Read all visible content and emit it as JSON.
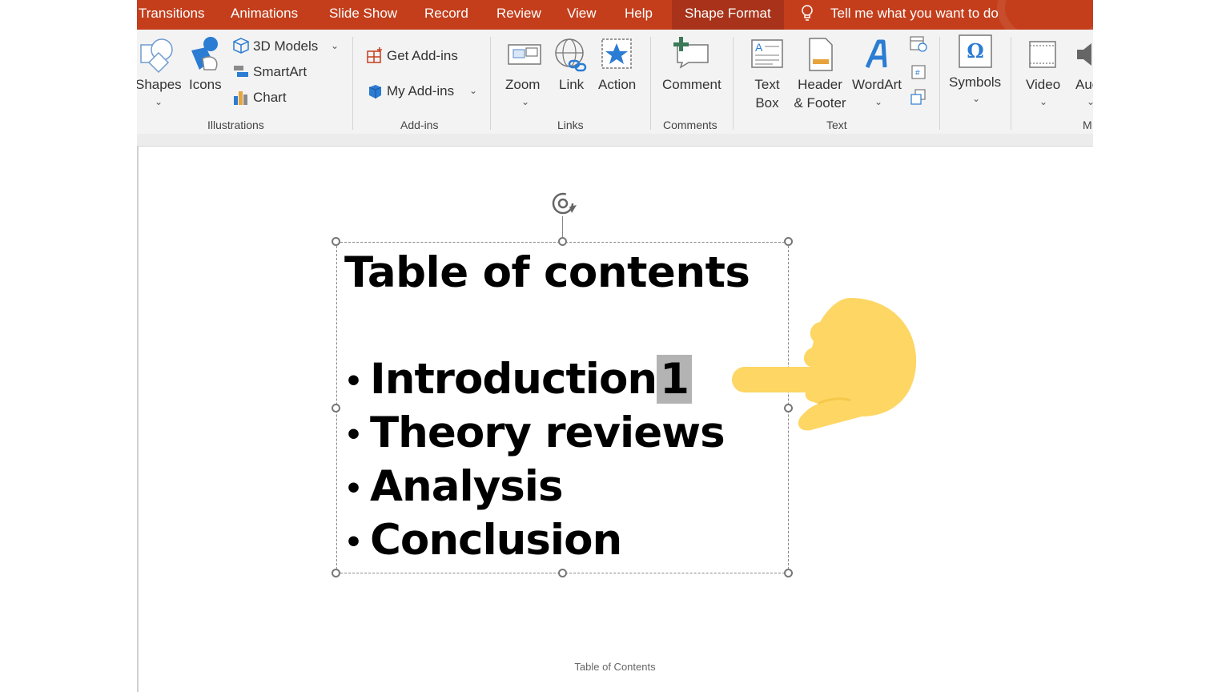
{
  "tabs": [
    {
      "label": "Transitions",
      "active": false
    },
    {
      "label": "Animations",
      "active": false
    },
    {
      "label": "Slide Show",
      "active": false
    },
    {
      "label": "Record",
      "active": false
    },
    {
      "label": "Review",
      "active": false
    },
    {
      "label": "View",
      "active": false
    },
    {
      "label": "Help",
      "active": false
    },
    {
      "label": "Shape Format",
      "active": true
    }
  ],
  "tell_me": "Tell me what you want to do",
  "ribbon": {
    "illustrations": {
      "shapes": "Shapes",
      "icons": "Icons",
      "models_3d": "3D Models",
      "smartart": "SmartArt",
      "chart": "Chart",
      "group": "Illustrations"
    },
    "addins": {
      "get": "Get Add-ins",
      "my": "My Add-ins",
      "group": "Add-ins"
    },
    "links": {
      "zoom": "Zoom",
      "link": "Link",
      "action": "Action",
      "group": "Links"
    },
    "comments": {
      "comment": "Comment",
      "group": "Comments"
    },
    "text": {
      "textbox_1": "Text",
      "textbox_2": "Box",
      "header_1": "Header",
      "header_2": "& Footer",
      "wordart": "WordArt",
      "group": "Text"
    },
    "symbols": {
      "symbols": "Symbols"
    },
    "media": {
      "video": "Video",
      "audio": "Auc",
      "group": "M"
    }
  },
  "slide": {
    "title": "Table of contents",
    "items": [
      {
        "text": "Introduction",
        "highlight": "1"
      },
      {
        "text": "Theory reviews"
      },
      {
        "text": "Analysis"
      },
      {
        "text": "Conclusion"
      }
    ],
    "footer": "Table of Contents"
  },
  "colors": {
    "tab_bar": "#c43e1c",
    "tab_active": "#a8331a",
    "ribbon_bg": "#f3f3f3",
    "icon_blue": "#2b7cd3",
    "hand": "#fdd663",
    "highlight": "#b3b3b3"
  },
  "icons": [
    "shapes-icon",
    "icons-icon",
    "cube-icon",
    "smartart-icon",
    "chart-icon",
    "addin-store-icon",
    "my-addins-icon",
    "zoom-icon",
    "link-icon",
    "action-star-icon",
    "comment-icon",
    "textbox-icon",
    "header-footer-icon",
    "wordart-icon",
    "date-time-icon",
    "slide-number-icon",
    "object-icon",
    "omega-icon",
    "video-icon",
    "audio-icon",
    "rotate-handle-icon",
    "pointing-hand-icon",
    "lightbulb-icon"
  ]
}
